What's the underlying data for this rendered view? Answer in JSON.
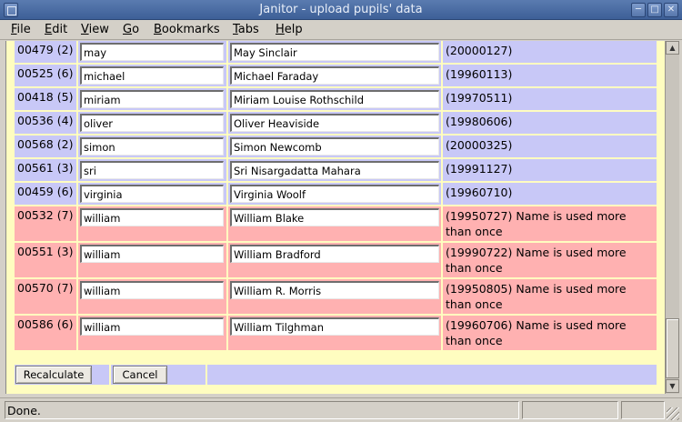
{
  "window": {
    "title": "Janitor - upload pupils' data"
  },
  "menu": [
    {
      "label": "File",
      "ul": "F",
      "rest": "ile"
    },
    {
      "label": "Edit",
      "ul": "E",
      "rest": "dit"
    },
    {
      "label": "View",
      "ul": "V",
      "rest": "iew"
    },
    {
      "label": "Go",
      "ul": "G",
      "rest": "o"
    },
    {
      "label": "Bookmarks",
      "ul": "B",
      "rest": "ookmarks"
    },
    {
      "label": "Tabs",
      "ul": "T",
      "rest": "abs"
    },
    {
      "label": "Help",
      "ul": "H",
      "rest": "elp"
    }
  ],
  "rows": [
    {
      "id": "00479 (2)",
      "login": "may",
      "name": "May Sinclair",
      "info": "(20000127)",
      "status": "ok"
    },
    {
      "id": "00525 (6)",
      "login": "michael",
      "name": "Michael Faraday",
      "info": "(19960113)",
      "status": "ok"
    },
    {
      "id": "00418 (5)",
      "login": "miriam",
      "name": "Miriam Louise Rothschild",
      "info": "(19970511)",
      "status": "ok"
    },
    {
      "id": "00536 (4)",
      "login": "oliver",
      "name": "Oliver Heaviside",
      "info": "(19980606)",
      "status": "ok"
    },
    {
      "id": "00568 (2)",
      "login": "simon",
      "name": "Simon Newcomb",
      "info": "(20000325)",
      "status": "ok"
    },
    {
      "id": "00561 (3)",
      "login": "sri",
      "name": "Sri Nisargadatta Mahara",
      "info": "(19991127)",
      "status": "ok"
    },
    {
      "id": "00459 (6)",
      "login": "virginia",
      "name": "Virginia Woolf",
      "info": "(19960710)",
      "status": "ok"
    },
    {
      "id": "00532 (7)",
      "login": "william",
      "name": "William Blake",
      "info": "(19950727) Name is used more than once",
      "status": "error"
    },
    {
      "id": "00551 (3)",
      "login": "william",
      "name": "William Bradford",
      "info": "(19990722) Name is used more than once",
      "status": "error"
    },
    {
      "id": "00570 (7)",
      "login": "william",
      "name": "William R. Morris",
      "info": "(19950805) Name is used more than once",
      "status": "error"
    },
    {
      "id": "00586 (6)",
      "login": "william",
      "name": "William Tilghman",
      "info": "(19960706) Name is used more than once",
      "status": "error"
    }
  ],
  "buttons": {
    "recalculate": "Recalculate",
    "cancel": "Cancel"
  },
  "status": {
    "text": "Done."
  },
  "colors": {
    "page_bg": "#fffdc0",
    "ok_row": "#c8c8f7",
    "error_row": "#ffb1b1"
  },
  "icons": {
    "window_menu": "window-menu-icon",
    "minimize": "minimize-icon",
    "maximize": "maximize-icon",
    "close": "close-icon"
  }
}
